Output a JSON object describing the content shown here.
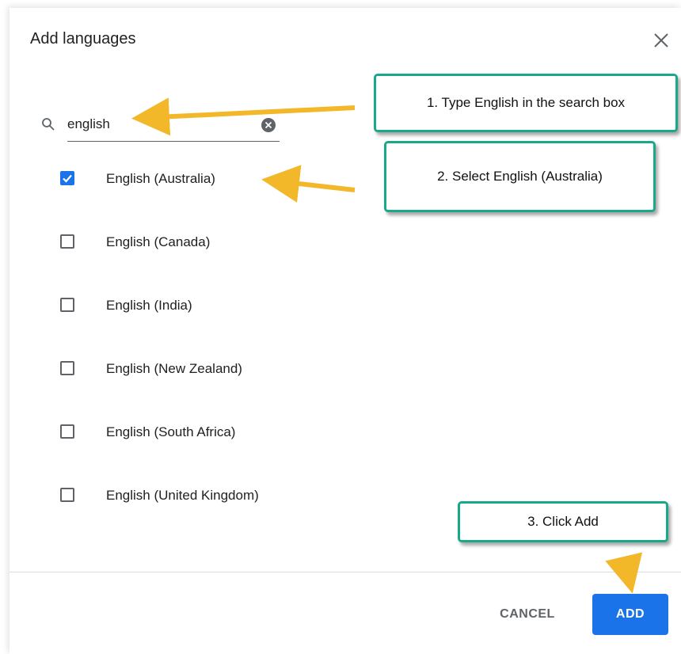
{
  "dialog": {
    "title": "Add languages",
    "close_icon": "close-icon",
    "search": {
      "icon": "search-icon",
      "value": "english",
      "clear_icon": "clear-icon"
    },
    "languages": [
      {
        "label": "English (Australia)",
        "checked": true
      },
      {
        "label": "English (Canada)",
        "checked": false
      },
      {
        "label": "English (India)",
        "checked": false
      },
      {
        "label": "English (New Zealand)",
        "checked": false
      },
      {
        "label": "English (South Africa)",
        "checked": false
      },
      {
        "label": "English (United Kingdom)",
        "checked": false
      }
    ],
    "buttons": {
      "cancel": "CANCEL",
      "add": "ADD"
    }
  },
  "annotations": {
    "step1": "1. Type English in the search box",
    "step2": "2. Select English (Australia)",
    "step3": "3. Click Add",
    "callout_border_color": "#1aa88b",
    "arrow_color": "#f3b829"
  },
  "colors": {
    "accent": "#1a73e8",
    "text": "#202124",
    "secondary": "#5f6368"
  }
}
